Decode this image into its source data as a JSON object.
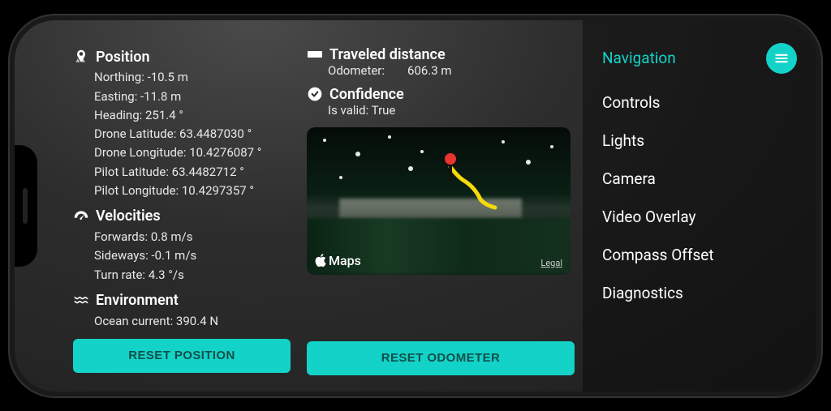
{
  "position": {
    "title": "Position",
    "northing": "Northing: -10.5 m",
    "easting": "Easting: -11.8 m",
    "heading": "Heading: 251.4 °",
    "drone_lat": "Drone Latitude: 63.4487030 °",
    "drone_lon": "Drone Longitude: 10.4276087 °",
    "pilot_lat": "Pilot Latitude: 63.4482712 °",
    "pilot_lon": "Pilot Longitude: 10.4297357 °"
  },
  "velocities": {
    "title": "Velocities",
    "forwards": "Forwards: 0.8 m/s",
    "sideways": "Sideways: -0.1 m/s",
    "turn_rate": "Turn rate: 4.3 °/s"
  },
  "environment": {
    "title": "Environment",
    "ocean_current": "Ocean current: 390.4 N"
  },
  "traveled": {
    "title": "Traveled distance",
    "odometer_label": "Odometer:",
    "odometer_value": "606.3 m"
  },
  "confidence": {
    "title": "Confidence",
    "is_valid": "Is valid: True"
  },
  "map": {
    "provider": "Maps",
    "legal": "Legal"
  },
  "buttons": {
    "reset_position": "RESET POSITION",
    "reset_odometer": "RESET ODOMETER"
  },
  "nav": {
    "items": [
      "Navigation",
      "Controls",
      "Lights",
      "Camera",
      "Video Overlay",
      "Compass Offset",
      "Diagnostics"
    ],
    "active_index": 0
  }
}
